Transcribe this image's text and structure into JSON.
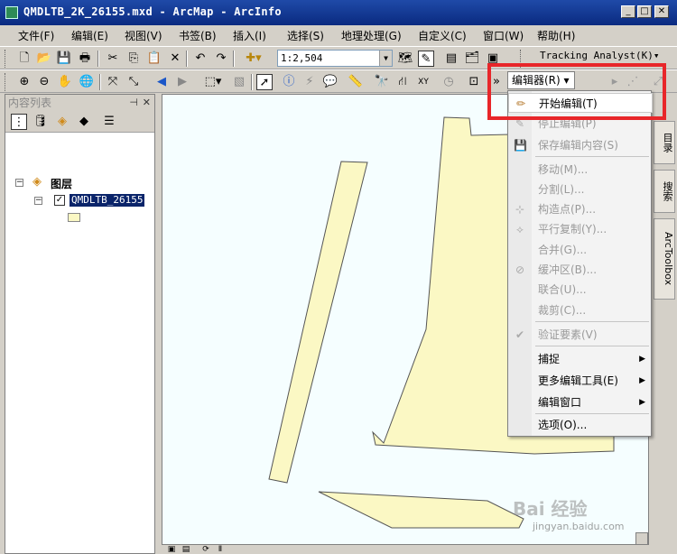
{
  "window": {
    "title": "QMDLTB_2K_26155.mxd - ArcMap - ArcInfo",
    "minimize": "_",
    "maximize": "□",
    "close": "✕"
  },
  "menubar": {
    "items": [
      "文件(F)",
      "编辑(E)",
      "视图(V)",
      "书签(B)",
      "插入(I)",
      "选择(S)",
      "地理处理(G)",
      "自定义(C)",
      "窗口(W)",
      "帮助(H)"
    ]
  },
  "toolbar": {
    "scale": "1:2,504",
    "tracking_analyst": "Tracking Analyst(K)▾"
  },
  "toc": {
    "title": "内容列表",
    "layers_label": "图层",
    "layer_name": "QMDLTB_26155",
    "layer_checked": "✓"
  },
  "editor": {
    "button_label": "编辑器(R) ▾"
  },
  "dropdown": {
    "items": [
      {
        "label": "开始编辑(T)",
        "enabled": true,
        "icon": "pencil-icon"
      },
      {
        "label": "停止编辑(P)",
        "enabled": false,
        "icon": "stop-edit-icon"
      },
      {
        "label": "保存编辑内容(S)",
        "enabled": false,
        "icon": "save-edits-icon"
      },
      {
        "label": "移动(M)...",
        "enabled": false
      },
      {
        "label": "分割(L)...",
        "enabled": false
      },
      {
        "label": "构造点(P)...",
        "enabled": false,
        "icon": "construct-points-icon"
      },
      {
        "label": "平行复制(Y)...",
        "enabled": false,
        "icon": "copy-parallel-icon"
      },
      {
        "label": "合并(G)...",
        "enabled": false
      },
      {
        "label": "缓冲区(B)...",
        "enabled": false,
        "icon": "buffer-icon"
      },
      {
        "label": "联合(U)...",
        "enabled": false
      },
      {
        "label": "裁剪(C)...",
        "enabled": false
      },
      {
        "label": "验证要素(V)",
        "enabled": false,
        "icon": "validate-icon"
      },
      {
        "label": "捕捉",
        "enabled": true,
        "submenu": true
      },
      {
        "label": "更多编辑工具(E)",
        "enabled": true,
        "submenu": true
      },
      {
        "label": "编辑窗口",
        "enabled": true,
        "submenu": true
      },
      {
        "label": "选项(O)...",
        "enabled": true
      }
    ]
  },
  "right_tabs": {
    "catalog": "目录",
    "search": "搜索",
    "toolbox": "ArcToolbox"
  },
  "watermark": {
    "brand": "Bai 经验",
    "url": "jingyan.baidu.com"
  },
  "colors": {
    "title_bar": "#0a2a80",
    "polygon_fill": "#fbf8c4",
    "map_background": "#f5feff",
    "highlight_box": "#e8262a",
    "layer_selected": "#0a246a"
  }
}
